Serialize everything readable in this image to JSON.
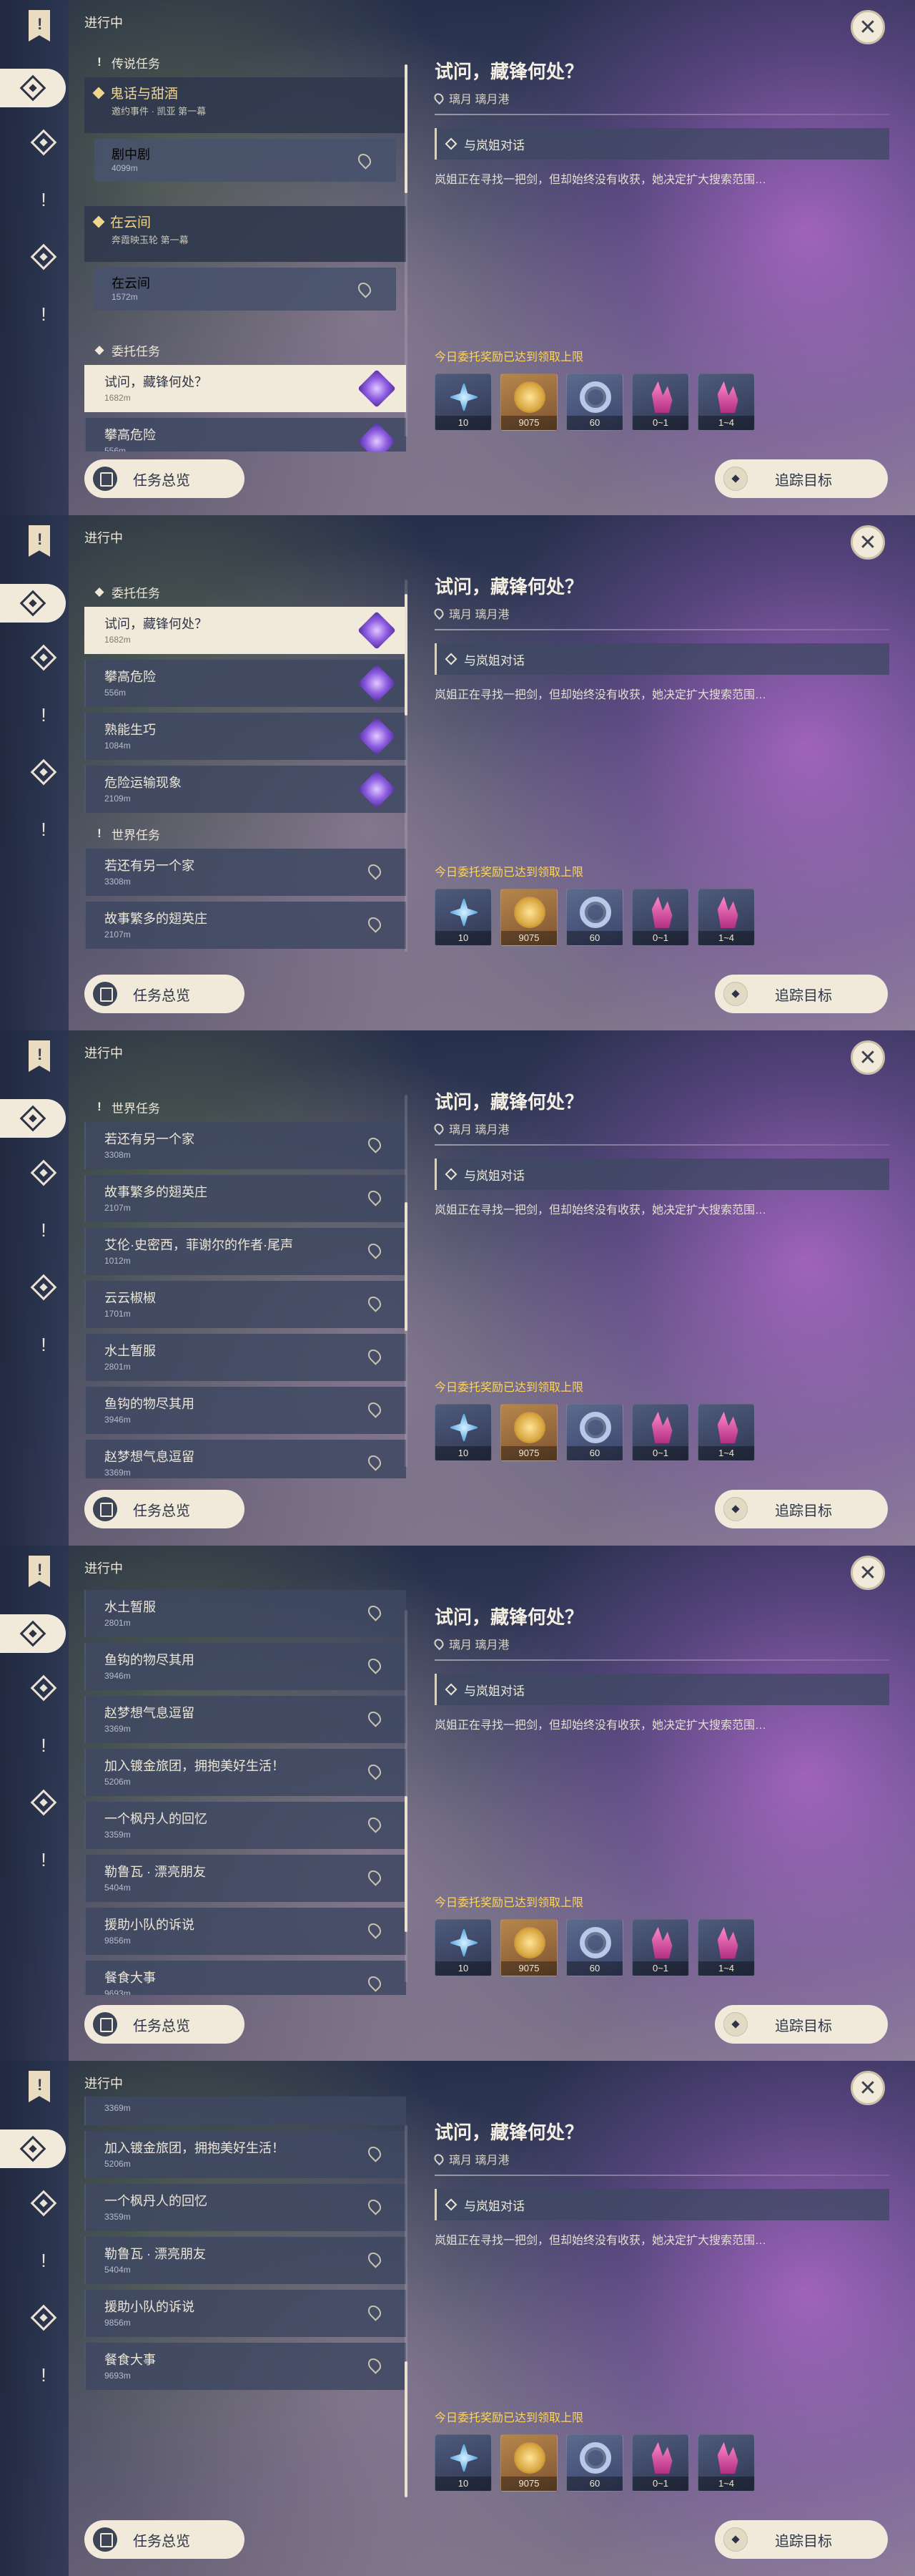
{
  "header": {
    "in_progress": "进行中",
    "close": "✕"
  },
  "categories": {
    "legend": "传说任务",
    "commission": "委托任务",
    "world": "世界任务"
  },
  "legend_quests": [
    {
      "title": "鬼话与甜酒",
      "subtitle": "邀约事件 · 凯亚 第一幕",
      "step": "剧中剧",
      "dist": "4099m"
    },
    {
      "title": "在云间",
      "subtitle": "奔霞映玉轮 第一幕",
      "step": "在云间",
      "dist": "1572m"
    }
  ],
  "commissions": [
    {
      "name": "试问，藏锋何处？",
      "dist": "1682m"
    },
    {
      "name": "攀高危险",
      "dist": "556m"
    },
    {
      "name": "熟能生巧",
      "dist": "1084m"
    },
    {
      "name": "危险运输现象",
      "dist": "2109m"
    }
  ],
  "world_quests": [
    {
      "name": "若还有另一个家",
      "dist": "3308m"
    },
    {
      "name": "故事繁多的翅英庄",
      "dist": "2107m"
    },
    {
      "name": "艾伦·史密西，菲谢尔的作者·尾声",
      "dist": "1012m"
    },
    {
      "name": "云云椒椒",
      "dist": "1701m"
    },
    {
      "name": "水土暂服",
      "dist": "2801m"
    },
    {
      "name": "鱼钩的物尽其用",
      "dist": "3946m"
    },
    {
      "name": "赵梦想气息逗留",
      "dist": "3369m"
    },
    {
      "name": "加入镀金旅团，拥抱美好生活！",
      "dist": "5206m"
    },
    {
      "name": "一个枫丹人的回忆",
      "dist": "3359m"
    },
    {
      "name": "勒鲁瓦 · 漂亮朋友",
      "dist": "5404m"
    },
    {
      "name": "援助小队的诉说",
      "dist": "9856m"
    },
    {
      "name": "餐食大事",
      "dist": "9693m"
    }
  ],
  "detail": {
    "title": "试问，藏锋何处？",
    "location": "璃月 璃月港",
    "step": "与岚姐对话",
    "description": "岚姐正在寻找一把剑，但却始终没有收获，她决定扩大搜索范围…",
    "reward_note": "今日委托奖励已达到领取上限",
    "rewards": [
      {
        "icon": "primogem-star-icon",
        "count": "10"
      },
      {
        "icon": "mora-coin-icon",
        "count": "9075"
      },
      {
        "icon": "adventure-exp-icon",
        "count": "60"
      },
      {
        "icon": "crystal-icon",
        "count": "0~1"
      },
      {
        "icon": "crystal-cluster-icon",
        "count": "1~4"
      }
    ]
  },
  "buttons": {
    "overview": "任务总览",
    "track": "追踪目标"
  },
  "colors": {
    "accent_gold": "#ffd45a",
    "cream": "#f1eadb",
    "purple_quest": "#8c5ce0"
  }
}
